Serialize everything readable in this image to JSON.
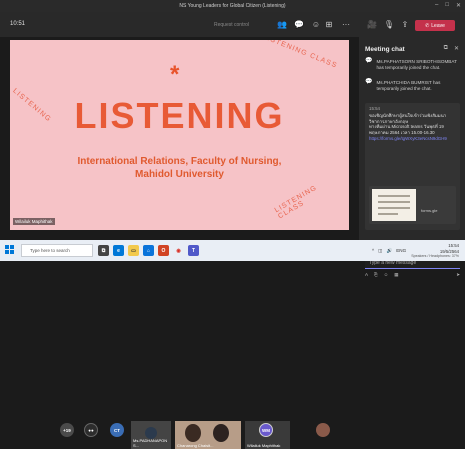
{
  "window": {
    "title": "NS Young Leaders for Global Citizen (Listening)"
  },
  "toolbar": {
    "time": "10:51",
    "notice": "Request control",
    "leave_label": "Leave"
  },
  "slide": {
    "star": "*",
    "heading": "LISTENING",
    "subtitle_line1": "International Relations, Faculty of Nursing,",
    "subtitle_line2": "Mahidol University",
    "deco_top": "LISTENING CLASS",
    "deco_left": "LISTENING",
    "deco_bottom": "LISTENING CLASS",
    "speaker": "Wilailuk Maphithak"
  },
  "chat": {
    "title": "Meeting chat",
    "system_messages": [
      "Ms.PAPHATSORN SRIBOTHISOMBAT has temporarily joined the chat.",
      "Ms.PHATCHIDA BUMRIST has temporarily joined the chat."
    ],
    "message": {
      "time": "15:54",
      "text_1": "ขอเชิญนักศึกษาผู้สนใจเข้าร่วมฟังสัมมนาวิชาการภาษาอังกฤษ",
      "text_2": "ทางทีมผ่าน Microsoft teams วันพุธที่ 19",
      "text_3": "พฤษภาคม 2564 เวลา 15.00-16.30",
      "link": "https://forms.gle/tgWXyK3eNcsN9dGH9",
      "preview_label": "forms.gle"
    },
    "compose_placeholder": "Type a new message"
  },
  "participants": {
    "avatars": [
      {
        "label": "+19",
        "color": "#4a4a4a"
      },
      {
        "label": "●●",
        "color": "#2d2d2d"
      },
      {
        "label": "CT",
        "color": "#3a6db5"
      }
    ],
    "tiles": [
      {
        "name": "Ms.PADHANAPON S..."
      },
      {
        "name": "Chanarong Chaisit..."
      },
      {
        "name": "Wilailuk Maphithak"
      }
    ],
    "wm_avatar": "WM"
  },
  "taskbar": {
    "search_placeholder": "Type here to search",
    "lang": "ENG",
    "time": "15:54",
    "date": "19/5/2564",
    "tray_text": "Speakers / Headphones: 37%"
  }
}
